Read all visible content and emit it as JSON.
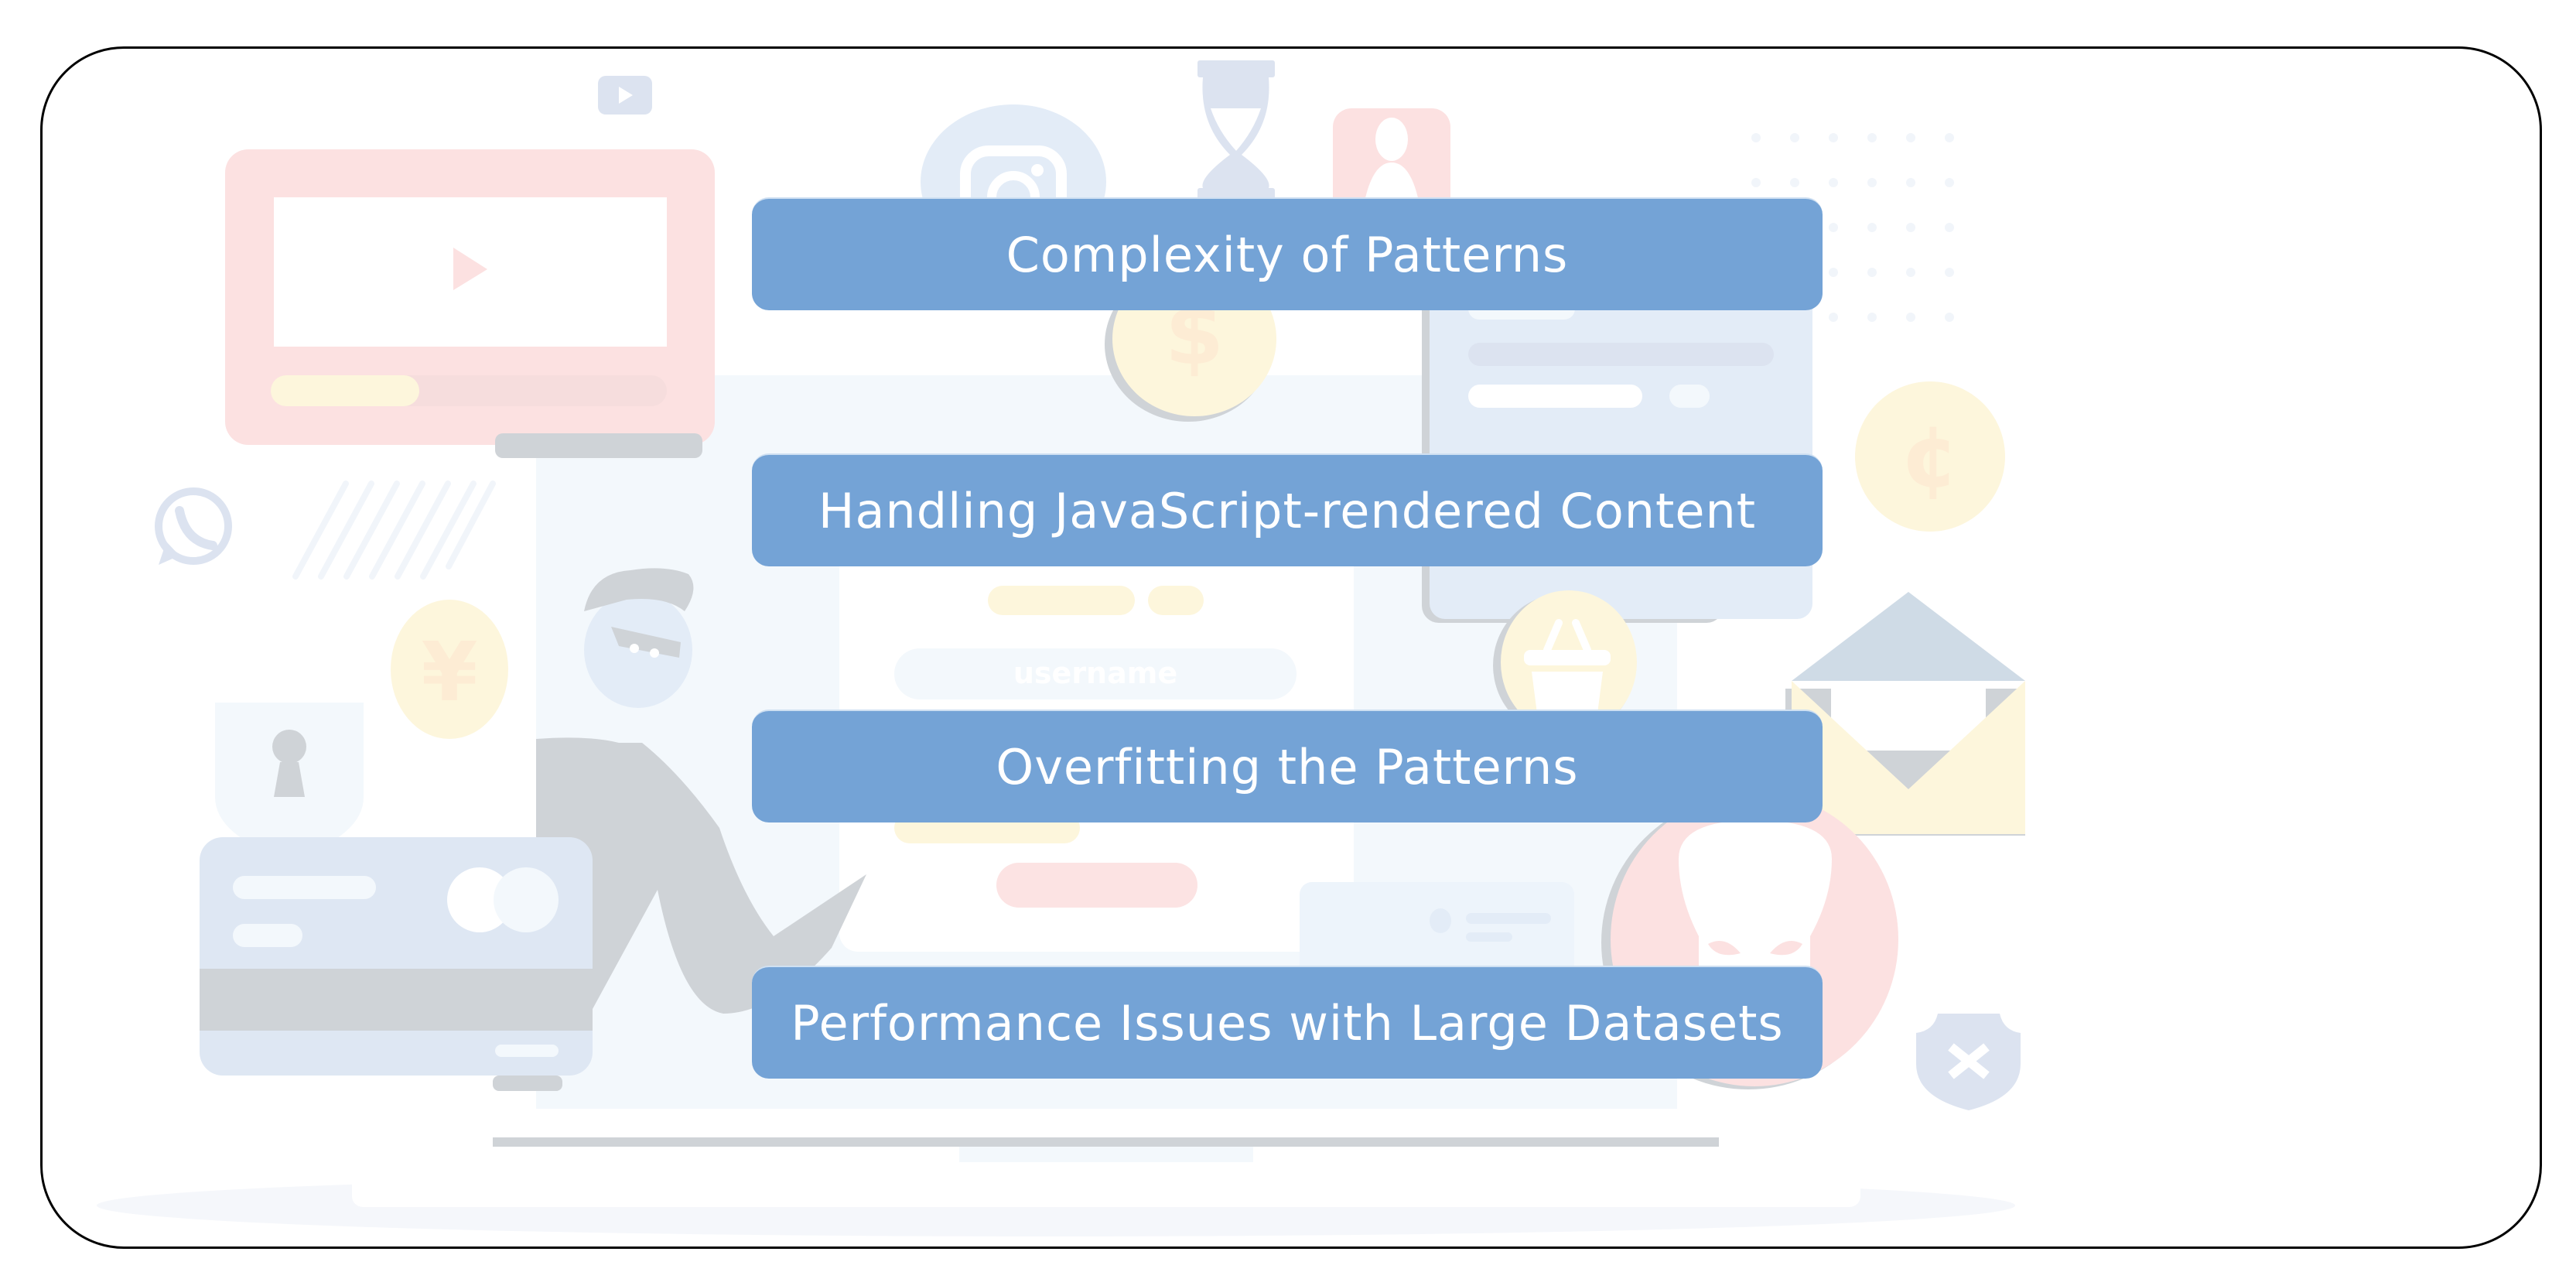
{
  "slide": {
    "items": [
      {
        "label": "Complexity of Patterns"
      },
      {
        "label": "Handling JavaScript-rendered Content"
      },
      {
        "label": "Overfitting the Patterns"
      },
      {
        "label": "Performance Issues with Large Datasets"
      }
    ],
    "background_illustration": {
      "login_field_placeholder": "username",
      "icons": [
        "youtube-icon",
        "video-player-icon",
        "instagram-icon",
        "hourglass-icon",
        "user-profile-icon",
        "dollar-coin-icon",
        "chat-window-icon",
        "cent-coin-icon",
        "whatsapp-icon",
        "hacker-person",
        "yen-coin-icon",
        "lock-shield-icon",
        "credit-card-icon",
        "shopping-basket-icon",
        "envelope-icon",
        "skull-icon",
        "x-shield-icon",
        "laptop"
      ]
    }
  },
  "colors": {
    "bar_fill": "#74A3D6",
    "bar_text": "#FFFFFF",
    "frame_border": "#000000"
  }
}
